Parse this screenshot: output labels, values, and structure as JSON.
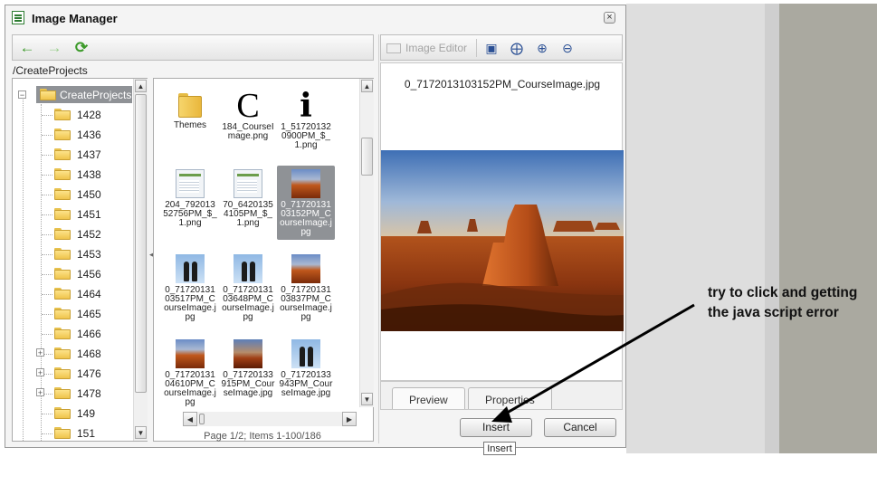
{
  "window": {
    "title": "Image Manager",
    "close_glyph": "×"
  },
  "left_toolbar": {
    "back_icon": "arrow-left-icon",
    "forward_icon": "arrow-right-icon",
    "refresh_icon": "refresh-icon"
  },
  "path": "/CreateProjects",
  "tree": {
    "root": "CreateProjects",
    "items": [
      {
        "label": "1428",
        "expandable": false
      },
      {
        "label": "1436",
        "expandable": false
      },
      {
        "label": "1437",
        "expandable": false
      },
      {
        "label": "1438",
        "expandable": false
      },
      {
        "label": "1450",
        "expandable": false
      },
      {
        "label": "1451",
        "expandable": false
      },
      {
        "label": "1452",
        "expandable": false
      },
      {
        "label": "1453",
        "expandable": false
      },
      {
        "label": "1456",
        "expandable": false
      },
      {
        "label": "1464",
        "expandable": false
      },
      {
        "label": "1465",
        "expandable": false
      },
      {
        "label": "1466",
        "expandable": false
      },
      {
        "label": "1468",
        "expandable": true
      },
      {
        "label": "1476",
        "expandable": true
      },
      {
        "label": "1478",
        "expandable": true
      },
      {
        "label": "149",
        "expandable": false
      },
      {
        "label": "151",
        "expandable": false
      }
    ]
  },
  "files": [
    {
      "name": "Themes",
      "thumb": "folder-big",
      "selected": false
    },
    {
      "name": "184_CourseImage.png",
      "thumb": "glyph-c",
      "selected": false
    },
    {
      "name": "1_517201320900PM_$_1.png",
      "thumb": "glyph-i",
      "selected": false
    },
    {
      "name": "204_79201352756PM_$_1.png",
      "thumb": "screen",
      "selected": false
    },
    {
      "name": "70_64201354105PM_$_1.png",
      "thumb": "screen",
      "selected": false
    },
    {
      "name": "0_7172013103152PM_CourseImage.jpg",
      "thumb": "desert",
      "selected": true
    },
    {
      "name": "0_7172013103517PM_CourseImage.jpg",
      "thumb": "penguins",
      "selected": false
    },
    {
      "name": "0_7172013103648PM_CourseImage.jpg",
      "thumb": "penguins",
      "selected": false
    },
    {
      "name": "0_7172013103837PM_CourseImage.jpg",
      "thumb": "desert",
      "selected": false
    },
    {
      "name": "0_7172013104610PM_CourseImage.jpg",
      "thumb": "desert",
      "selected": false
    },
    {
      "name": "0_71720133915PM_CourseImage.jpg",
      "thumb": "desert2",
      "selected": false
    },
    {
      "name": "0_71720133943PM_CourseImage.jpg",
      "thumb": "penguins",
      "selected": false
    }
  ],
  "pager": {
    "text": "Page 1/2; Items 1-100/186"
  },
  "right_toolbar": {
    "image_editor_label": "Image Editor",
    "icons": [
      "best-fit-icon",
      "actual-size-icon",
      "zoom-in-icon",
      "zoom-out-icon"
    ]
  },
  "preview": {
    "filename": "0_7172013103152PM_CourseImage.jpg"
  },
  "tabs": [
    {
      "label": "Preview",
      "active": true
    },
    {
      "label": "Properties",
      "active": false
    }
  ],
  "buttons": {
    "insert": "Insert",
    "cancel": "Cancel"
  },
  "tooltip": "Insert",
  "annotation": {
    "line1": "try to click and getting",
    "line2": "the java script error"
  },
  "colors": {
    "selection": "#8f9296",
    "accent_green": "#2e7d32",
    "annotation_arrow": "#000000"
  }
}
